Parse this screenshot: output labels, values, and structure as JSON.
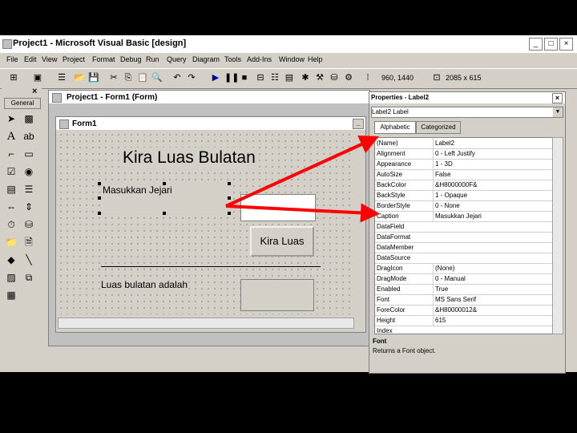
{
  "window": {
    "title": "Project1 - Microsoft Visual Basic [design]",
    "min": "_",
    "max": "□",
    "close": "×"
  },
  "menu": [
    "File",
    "Edit",
    "View",
    "Project",
    "Format",
    "Debug",
    "Run",
    "Query",
    "Diagram",
    "Tools",
    "Add-Ins",
    "Window",
    "Help"
  ],
  "toolbar": {
    "position": "960, 1440",
    "size": "2085 x 615"
  },
  "toolbox": {
    "close": "×",
    "tab": "General"
  },
  "project_window": {
    "title": "Project1 - Form1 (Form)"
  },
  "form_window": {
    "title": "Form1"
  },
  "form": {
    "title_label": "Kira Luas Bulatan",
    "radius_label": "Masukkan Jejari",
    "calc_button": "Kira Luas",
    "result_label": "Luas bulatan adalah"
  },
  "properties": {
    "title": "Properties - Label2",
    "object": "Label2 Label",
    "tabs": [
      "Alphabetic",
      "Categorized"
    ],
    "rows": [
      {
        "name": "(Name)",
        "value": "Label2"
      },
      {
        "name": "Alignment",
        "value": "0 - Left Justify"
      },
      {
        "name": "Appearance",
        "value": "1 - 3D"
      },
      {
        "name": "AutoSize",
        "value": "False"
      },
      {
        "name": "BackColor",
        "value": "&H8000000F&"
      },
      {
        "name": "BackStyle",
        "value": "1 - Opaque"
      },
      {
        "name": "BorderStyle",
        "value": "0 - None"
      },
      {
        "name": "Caption",
        "value": "Masukkan Jejari"
      },
      {
        "name": "DataField",
        "value": ""
      },
      {
        "name": "DataFormat",
        "value": ""
      },
      {
        "name": "DataMember",
        "value": ""
      },
      {
        "name": "DataSource",
        "value": ""
      },
      {
        "name": "DragIcon",
        "value": "(None)"
      },
      {
        "name": "DragMode",
        "value": "0 - Manual"
      },
      {
        "name": "Enabled",
        "value": "True"
      },
      {
        "name": "Font",
        "value": "MS Sans Serif"
      },
      {
        "name": "ForeColor",
        "value": "&H80000012&"
      },
      {
        "name": "Height",
        "value": "615"
      },
      {
        "name": "Index",
        "value": ""
      }
    ],
    "desc_title": "Font",
    "desc_text": "Returns a Font object."
  },
  "colors": {
    "arrow": "#ff0000",
    "gray": "#d4d0c8"
  }
}
